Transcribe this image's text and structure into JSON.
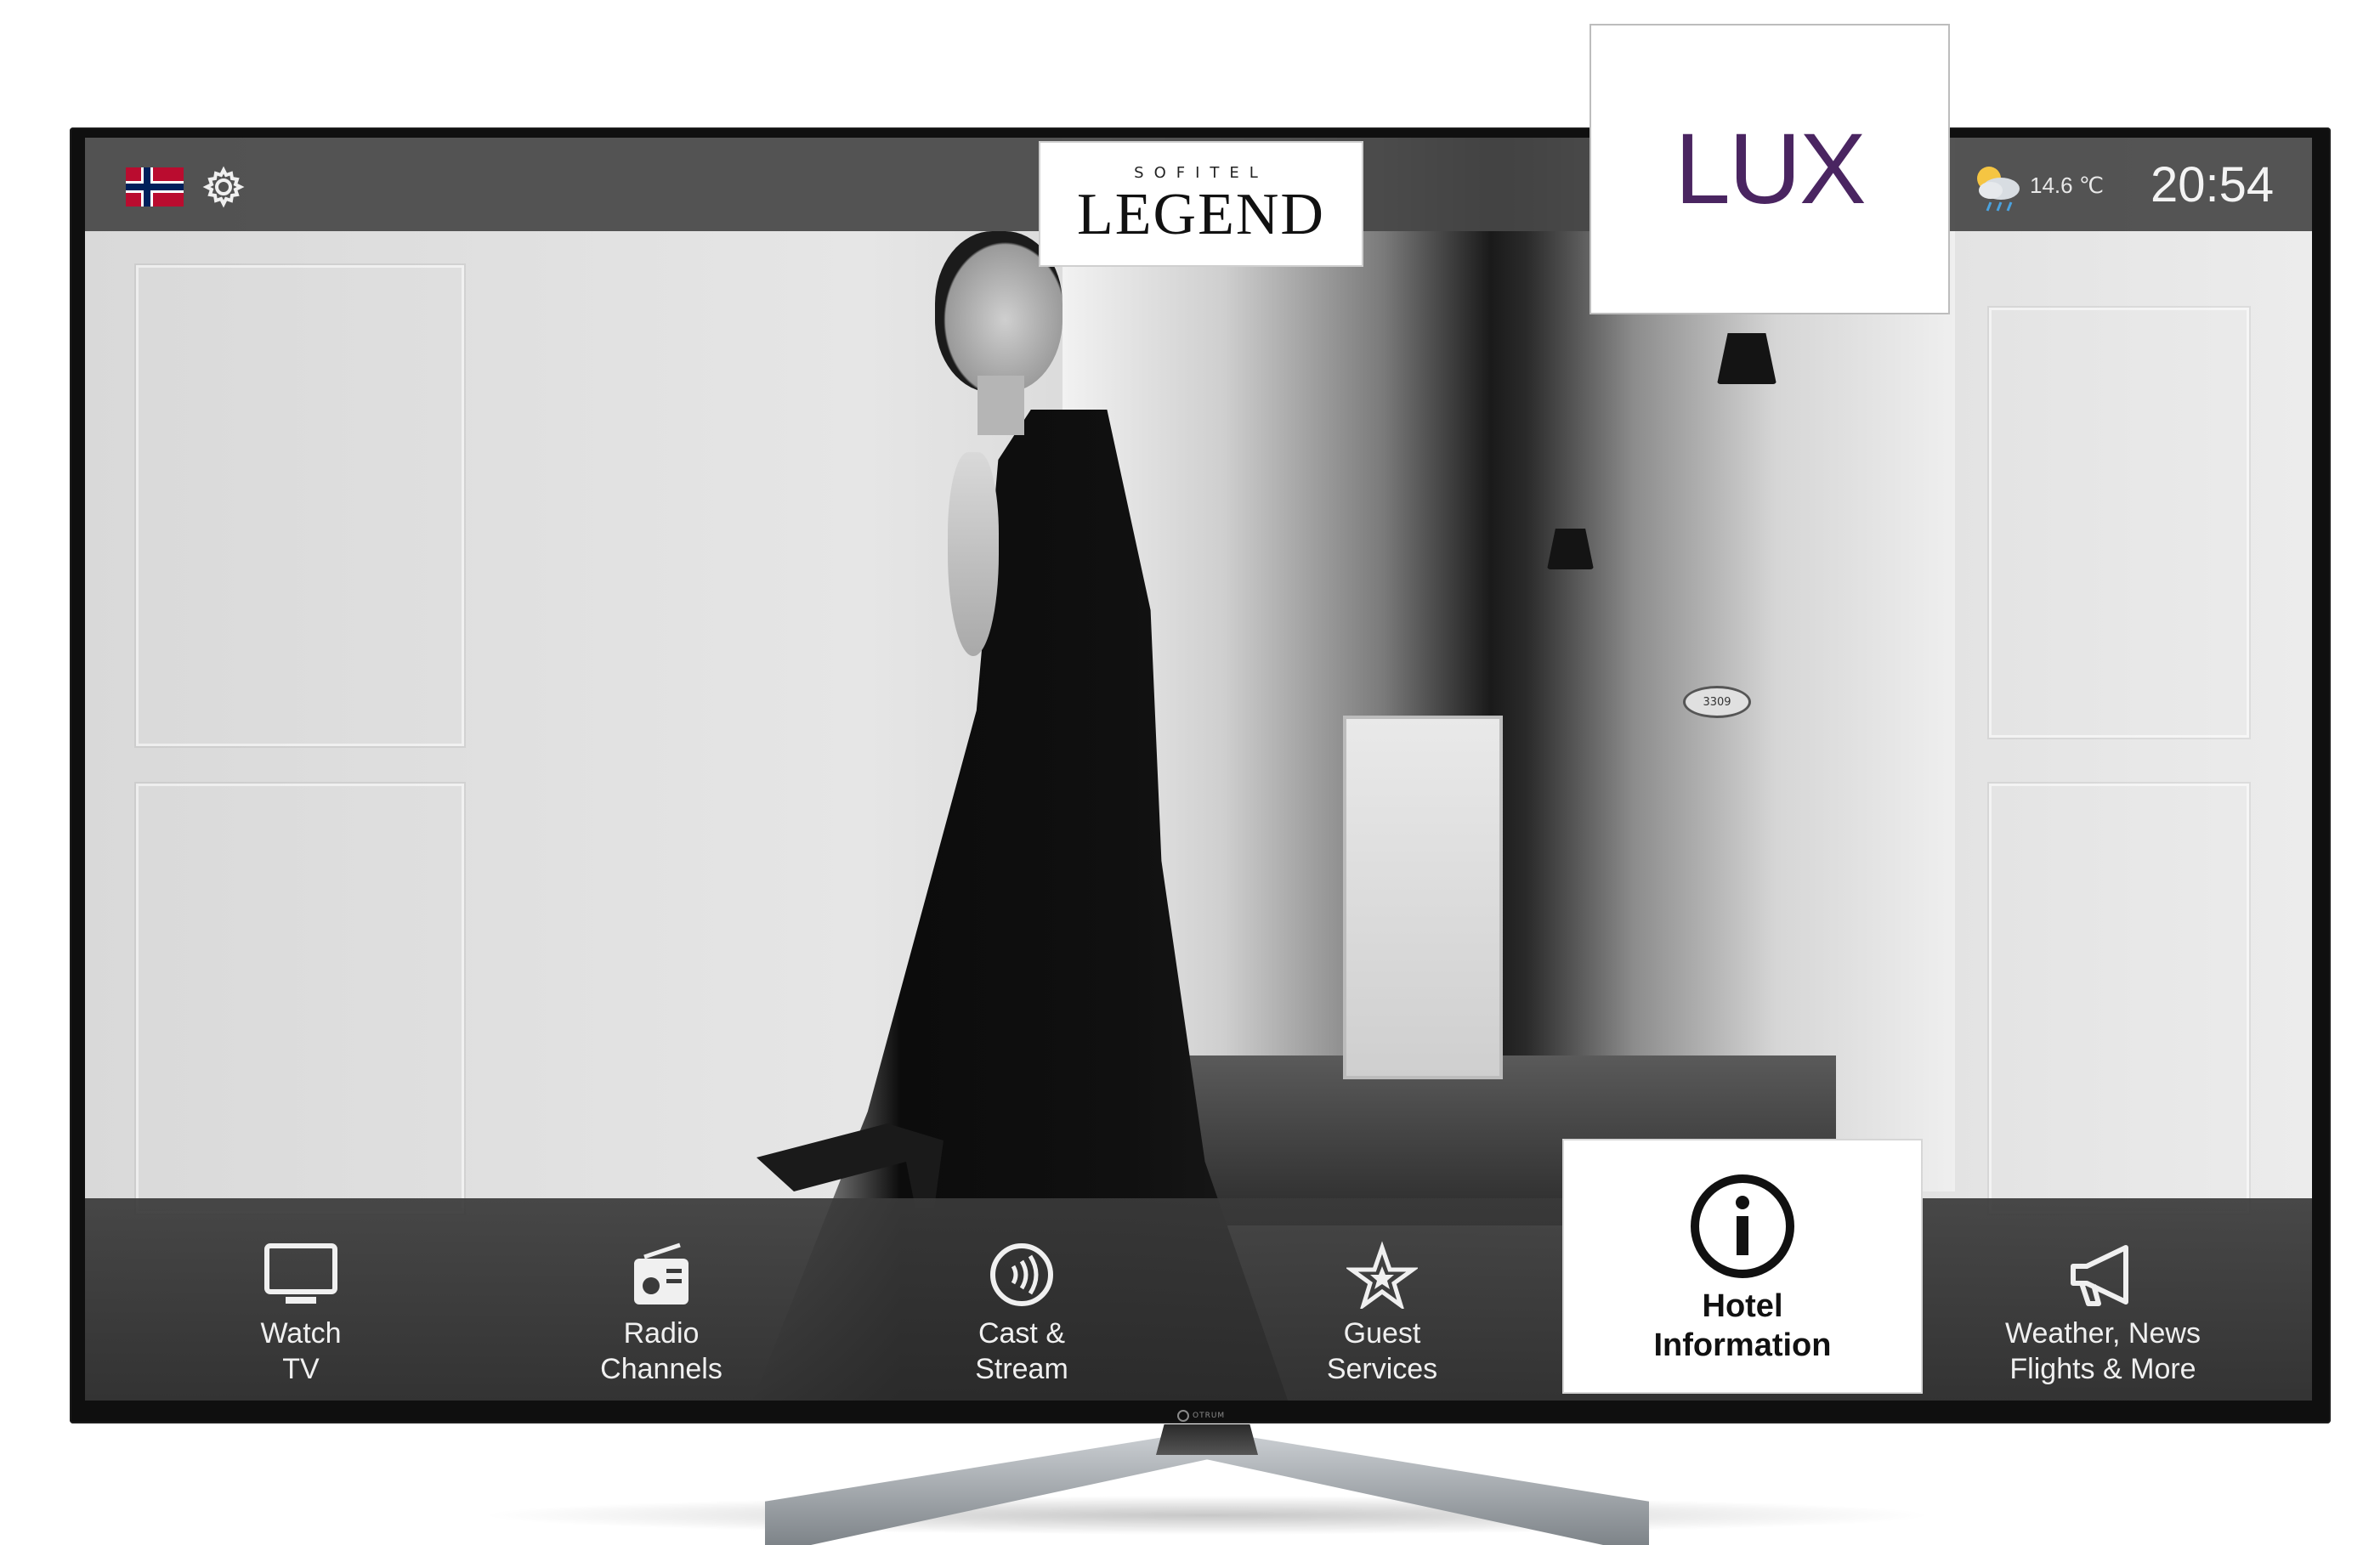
{
  "header": {
    "language_flag": "norway-flag",
    "settings_icon": "gear-icon",
    "logo_sub": "SOFITEL",
    "logo_main": "LEGEND",
    "partner_logo": "LUX",
    "weather_icon": "partly-cloudy-rain-icon",
    "temperature": "14.6 ℃",
    "time": "20:54"
  },
  "background": {
    "room_number": "3309"
  },
  "tv": {
    "brand": "OTRUM"
  },
  "menu": {
    "items": [
      {
        "line1": "Watch",
        "line2": "TV",
        "icon": "tv-icon",
        "active": false
      },
      {
        "line1": "Radio",
        "line2": "Channels",
        "icon": "radio-icon",
        "active": false
      },
      {
        "line1": "Cast &",
        "line2": "Stream",
        "icon": "cast-icon",
        "active": false
      },
      {
        "line1": "Guest",
        "line2": "Services",
        "icon": "star-services-icon",
        "active": false
      },
      {
        "line1": "Hotel",
        "line2": "Information",
        "icon": "info-icon",
        "active": true
      },
      {
        "line1": "Weather, News",
        "line2": "Flights & More",
        "icon": "megaphone-icon",
        "active": false
      }
    ]
  },
  "colors": {
    "lux_purple": "#4a2561",
    "bar_gray": "#464646",
    "active_tile": "#ffffff"
  }
}
